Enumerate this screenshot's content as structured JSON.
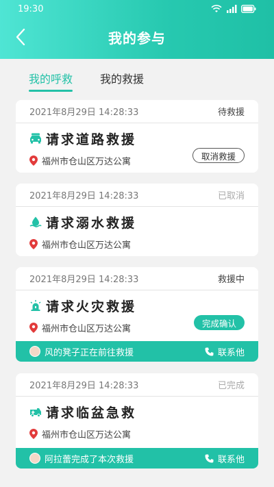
{
  "status_bar": {
    "time": "19:30"
  },
  "header": {
    "title": "我的参与"
  },
  "tabs": [
    {
      "label": "我的呼救",
      "active": true
    },
    {
      "label": "我的救援",
      "active": false
    }
  ],
  "colors": {
    "accent": "#22c1a7",
    "status_muted": "#aaaaaa",
    "status_dark": "#444444",
    "pin": "#e23b3b"
  },
  "cards": [
    {
      "time": "2021年8月29日   14:28:33",
      "status": "待救援",
      "icon": "car-icon",
      "title": "请求道路救援",
      "address": "福州市仓山区万达公寓",
      "action": "取消救援"
    },
    {
      "time": "2021年8月29日   14:28:33",
      "status": "已取消",
      "icon": "water-drop-icon",
      "title": "请求溺水救援",
      "address": "福州市仓山区万达公寓"
    },
    {
      "time": "2021年8月29日   14:28:33",
      "status": "救援中",
      "icon": "alarm-light-icon",
      "title": "请求火灾救援",
      "address": "福州市仓山区万达公寓",
      "action": "完成确认",
      "footer_text": "风的凳子正在前往救援",
      "footer_contact": "联系他"
    },
    {
      "time": "2021年8月29日   14:28:33",
      "status": "已完成",
      "icon": "ambulance-icon",
      "title": "请求临盆急救",
      "address": "福州市仓山区万达公寓",
      "footer_text": "阿拉蕾完成了本次救援",
      "footer_contact": "联系他"
    }
  ]
}
